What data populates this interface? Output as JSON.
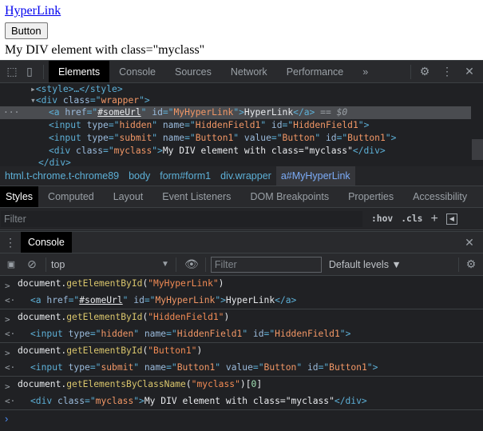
{
  "page": {
    "link": "HyperLink",
    "button": "Button",
    "div_text": "My DIV element with class=\"myclass\""
  },
  "devtools": {
    "tabs": [
      "Elements",
      "Console",
      "Sources",
      "Network",
      "Performance"
    ],
    "more": "»",
    "dom": {
      "style_line": "<style>…</style>",
      "wrapper_open": [
        "<div ",
        "class",
        "=\"",
        "wrapper",
        "\">"
      ],
      "selected_suffix": " == $0",
      "a": {
        "open": "<a ",
        "href": "href",
        "href_val": "#someUrl",
        "id": "id",
        "id_val": "MyHyperLink",
        "text": "HyperLink",
        "close": "</a>"
      },
      "hidden": {
        "name_val": "HiddenField1",
        "id_val": "HiddenField1",
        "type_val": "hidden"
      },
      "submit": {
        "type_val": "submit",
        "name_val": "Button1",
        "value_val": "Button",
        "id_val": "Button1"
      },
      "div": {
        "class_val": "myclass",
        "text": "My DIV element with class=\"myclass\""
      },
      "close": "</div>"
    },
    "breadcrumbs": [
      "html.t-chrome.t-chrome89",
      "body",
      "form#form1",
      "div.wrapper",
      "a#MyHyperLink"
    ],
    "style_tabs": [
      "Styles",
      "Computed",
      "Layout",
      "Event Listeners",
      "DOM Breakpoints",
      "Properties",
      "Accessibility"
    ],
    "styles_filter_placeholder": "Filter",
    "hov": ":hov",
    "cls": ".cls",
    "plus": "+"
  },
  "console": {
    "title": "Console",
    "context": "top",
    "filter_placeholder": "Filter",
    "levels": "Default levels ▼",
    "entries": [
      {
        "obj": "document.",
        "method": "getElementById",
        "arg": "\"MyHyperLink\""
      },
      {
        "obj": "document.",
        "method": "getElementById",
        "arg": "\"HiddenField1\""
      },
      {
        "obj": "document.",
        "method": "getElementById",
        "arg": "\"Button1\""
      },
      {
        "obj": "document.",
        "method": "getElementsByClassName",
        "arg": "\"myclass\"",
        "index": "0"
      }
    ]
  }
}
